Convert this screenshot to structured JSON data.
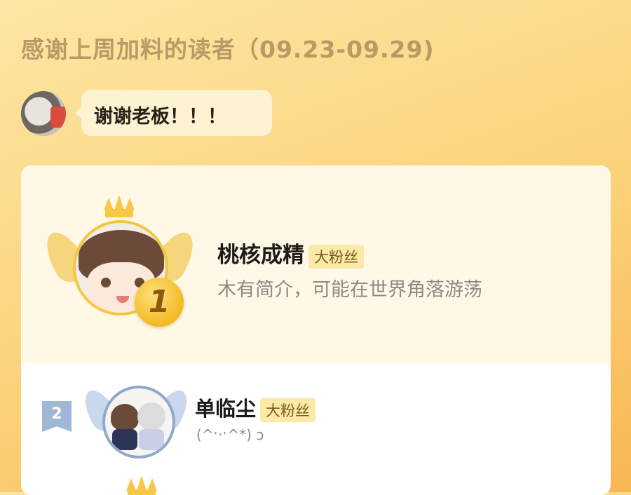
{
  "header": {
    "title": "感谢上周加料的读者（09.23-09.29)"
  },
  "owner": {
    "message": "谢谢老板！！！"
  },
  "ranking": [
    {
      "rank": "1",
      "name": "桃核成精",
      "tag": "大粉丝",
      "bio": "木有简介，可能在世界角落游荡"
    },
    {
      "rank": "2",
      "name": "单临尘",
      "tag": "大粉丝",
      "bio": "(^ˑ·ˑ^*) ͻ"
    }
  ],
  "colors": {
    "accent_gold": "#f5c63f",
    "rank2_blue": "#8fa9cb",
    "background": "#fbd27a"
  }
}
